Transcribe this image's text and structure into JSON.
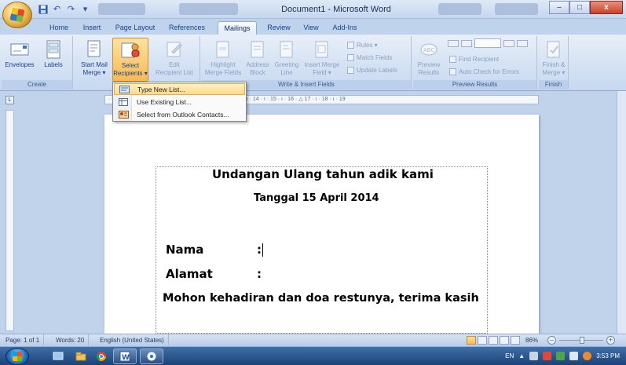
{
  "window": {
    "title": "Document1 - Microsoft Word",
    "controls": {
      "minimize": "–",
      "maximize": "□",
      "close": "x"
    }
  },
  "quick_access": {
    "undo_glyph": "↶",
    "redo_glyph": "↷",
    "more_glyph": "▾"
  },
  "tabs": [
    "Home",
    "Insert",
    "Page Layout",
    "References",
    "Mailings",
    "Review",
    "View",
    "Add-Ins"
  ],
  "active_tab": "Mailings",
  "ribbon": {
    "groups": {
      "create": "Create",
      "start": "",
      "write": "Write & Insert Fields",
      "preview": "Preview Results",
      "finish": "Finish"
    },
    "buttons": {
      "envelopes": "Envelopes",
      "labels": "Labels",
      "start_mail_merge": [
        "Start Mail",
        "Merge ▾"
      ],
      "select_recipients": [
        "Select",
        "Recipients ▾"
      ],
      "edit_recipient_list": [
        "Edit",
        "Recipient List"
      ],
      "highlight_merge_fields": [
        "Highlight",
        "Merge Fields"
      ],
      "address_block": [
        "Address",
        "Block"
      ],
      "greeting_line": [
        "Greeting",
        "Line"
      ],
      "insert_merge_field": [
        "Insert Merge",
        "Field ▾"
      ],
      "rules": "Rules ▾",
      "match_fields": "Match Fields",
      "update_labels": "Update Labels",
      "preview_results": [
        "Preview",
        "Results"
      ],
      "find_recipient": "Find Recipient",
      "auto_check_errors": "Auto Check for Errors",
      "finish_merge": [
        "Finish &",
        "Merge ▾"
      ]
    }
  },
  "dropdown": {
    "items": [
      {
        "label": "Type New List...",
        "icon": "new-list-icon"
      },
      {
        "label": "Use Existing List...",
        "icon": "existing-list-icon"
      },
      {
        "label": "Select from Outlook Contacts...",
        "icon": "outlook-contacts-icon"
      }
    ]
  },
  "ruler": {
    "button": "L",
    "text": "· 5 · ı · 6 · ı · 7 · ı · 8 · ı · 9 · ı · 10 · ı · 11 · ı · 12 · ı · 13 · ı · 14 · ı · 15 · ı · 16 · △ 17 · ı · 18 · ı · 19"
  },
  "document": {
    "line1": "Undangan Ulang tahun adik kami",
    "line2": "Tanggal 15 April 2014",
    "label_nama": "Nama",
    "colon_nama": ":",
    "label_alamat": "Alamat",
    "colon_alamat": ":",
    "line3": "Mohon kehadiran dan doa restunya, terima kasih"
  },
  "statusbar": {
    "page": "Page: 1 of 1",
    "words": "Words: 20",
    "language": "English (United States)",
    "zoom": "86%",
    "zoom_out": "–",
    "zoom_in": "+"
  },
  "taskbar": {
    "language": "EN",
    "clock": "3:53 PM"
  },
  "colors": {
    "ribbon_bg": "#d3e1f3",
    "active_button": "#f7b955",
    "close_button": "#c9402a",
    "taskbar": "#1c4277"
  }
}
